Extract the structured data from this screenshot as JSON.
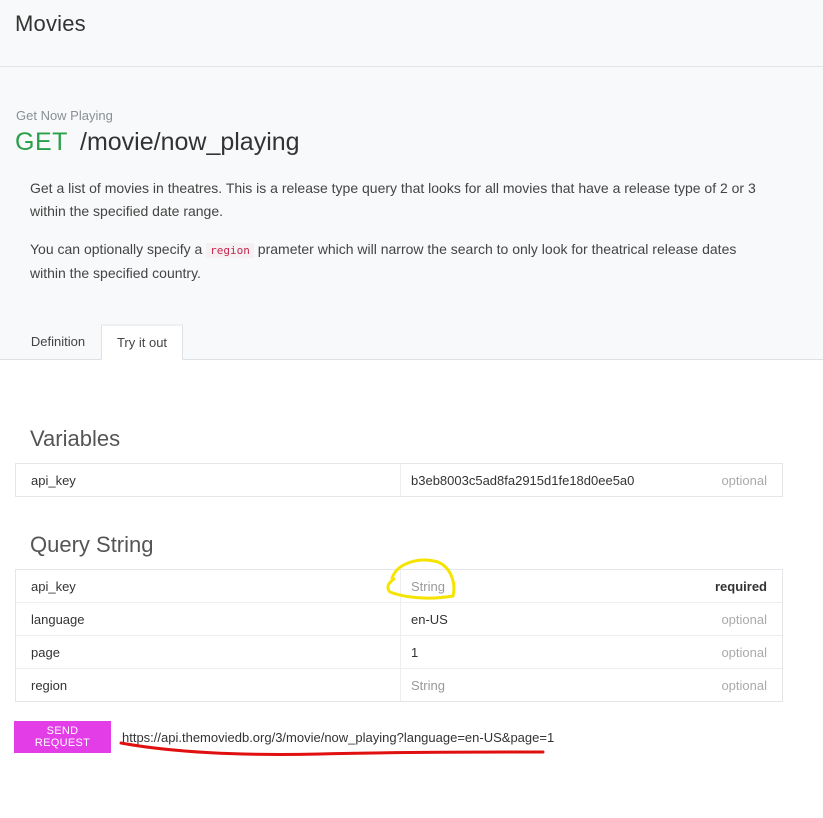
{
  "header": {
    "title": "Movies"
  },
  "endpoint": {
    "subtitle": "Get Now Playing",
    "method": "GET",
    "path": "/movie/now_playing",
    "description_1": "Get a list of movies in theatres. This is a release type query that looks for all movies that have a release type of 2 or 3 within the specified date range.",
    "description_2_before": "You can optionally specify a ",
    "description_2_code": "region",
    "description_2_after": " prameter which will narrow the search to only look for theatrical release dates within the specified country."
  },
  "tabs": [
    {
      "label": "Definition",
      "active": false
    },
    {
      "label": "Try it out",
      "active": true
    }
  ],
  "variables": {
    "title": "Variables",
    "rows": [
      {
        "name": "api_key",
        "value": "b3eb8003c5ad8fa2915d1fe18d0ee5a0",
        "requirement": "optional"
      }
    ]
  },
  "query_string": {
    "title": "Query String",
    "rows": [
      {
        "name": "api_key",
        "value": "String",
        "requirement": "required"
      },
      {
        "name": "language",
        "value": "en-US",
        "requirement": "optional"
      },
      {
        "name": "page",
        "value": "1",
        "requirement": "optional"
      },
      {
        "name": "region",
        "value": "String",
        "requirement": "optional"
      }
    ]
  },
  "request": {
    "button_label": "SEND REQUEST",
    "url": "https://api.themoviedb.org/3/movie/now_playing?language=en-US&page=1"
  },
  "colors": {
    "method_green": "#2ba04a",
    "send_button": "#e33de8",
    "annotation_yellow": "#f5e400",
    "annotation_red": "#e01010"
  }
}
